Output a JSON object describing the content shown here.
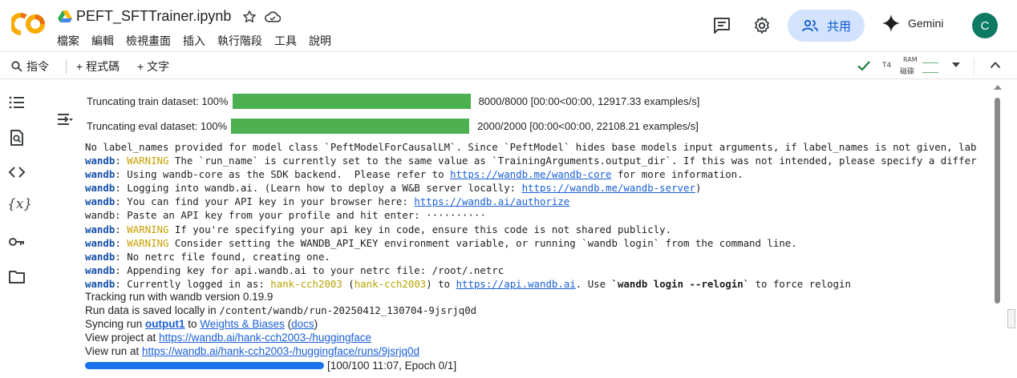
{
  "header": {
    "notebook_title": "PEFT_SFTTrainer.ipynb",
    "menu": [
      "檔案",
      "編輯",
      "檢視畫面",
      "插入",
      "執行階段",
      "工具",
      "說明"
    ],
    "share_label": "共用",
    "gemini_label": "Gemini",
    "avatar_letter": "C"
  },
  "toolbar": {
    "command_label": "指令",
    "add_code_label": "+ 程式碼",
    "add_text_label": "+ 文字",
    "runtime_type": "T4",
    "ram_label": "RAM",
    "disk_label": "磁碟"
  },
  "output": {
    "progress_rows": [
      {
        "label": "Truncating train dataset: 100%",
        "stats": "8000/8000 [00:00<00:00, 12917.33 examples/s]",
        "fraction": 1.0
      },
      {
        "label": "Truncating eval dataset: 100%",
        "stats": "2000/2000 [00:00<00:00, 22108.21 examples/s]",
        "fraction": 1.0
      }
    ],
    "log": {
      "l1": "No label_names provided for model class `PeftModelForCausalLM`. Since `PeftModel` hides base models input arguments, if label_names is not given, lab",
      "wandb": "wandb",
      "warning": "WARNING",
      "l2": " The `run_name` is currently set to the same value as `TrainingArguments.output_dir`. If this was not intended, please specify a differ",
      "l3a": ": Using wandb-core as the SDK backend.  Please refer to ",
      "l3link": "https://wandb.me/wandb-core",
      "l3b": " for more information.",
      "l4a": ": Logging into wandb.ai. (Learn how to deploy a W&B server locally: ",
      "l4link": "https://wandb.me/wandb-server",
      "l4b": ")",
      "l5a": ": You can find your API key in your browser here: ",
      "l5link": "https://wandb.ai/authorize",
      "l6": "wandb: Paste an API key from your profile and hit enter: ··········",
      "l7": " If you're specifying your api key in code, ensure this code is not shared publicly.",
      "l8": " Consider setting the WANDB_API_KEY environment variable, or running `wandb login` from the command line.",
      "l9": ": No netrc file found, creating one.",
      "l10": ": Appending key for api.wandb.ai to your netrc file: /root/.netrc",
      "l11a": ": Currently logged in as: ",
      "l11user": "hank-cch2003",
      "l11paren_open": " (",
      "l11paren_close": ")",
      "l11to": " to ",
      "l11link": "https://api.wandb.ai",
      "l11b": ". Use ",
      "l11cmd": "`wandb login --relogin`",
      "l11c": " to force relogin"
    },
    "tracking": "Tracking run with wandb version 0.19.9",
    "run_data_prefix": "Run data is saved locally in ",
    "run_data_path": "/content/wandb/run-20250412_130704-9jsrjq0d",
    "sync_prefix": "Syncing run ",
    "sync_run": "output1",
    "sync_to": " to ",
    "sync_target": "Weights & Biases",
    "sync_open": " (",
    "sync_docs": "docs",
    "sync_close": ")",
    "project_prefix": "View project at ",
    "project_link": "https://wandb.ai/hank-cch2003-/huggingface",
    "run_prefix": "View run at ",
    "run_link": "https://wandb.ai/hank-cch2003-/huggingface/runs/9jsrjq0d",
    "train_progress": "[100/100 11:07, Epoch 0/1]",
    "train_fraction": 1.0
  },
  "colors": {
    "accent": "#0b57d0",
    "share_bg": "#d3e3fd",
    "progress_green": "#4caf50",
    "progress_blue": "#1a73e8",
    "avatar": "#0e7a63",
    "wandb_blue": "#1550a8",
    "warning_yellow": "#c9a000"
  }
}
